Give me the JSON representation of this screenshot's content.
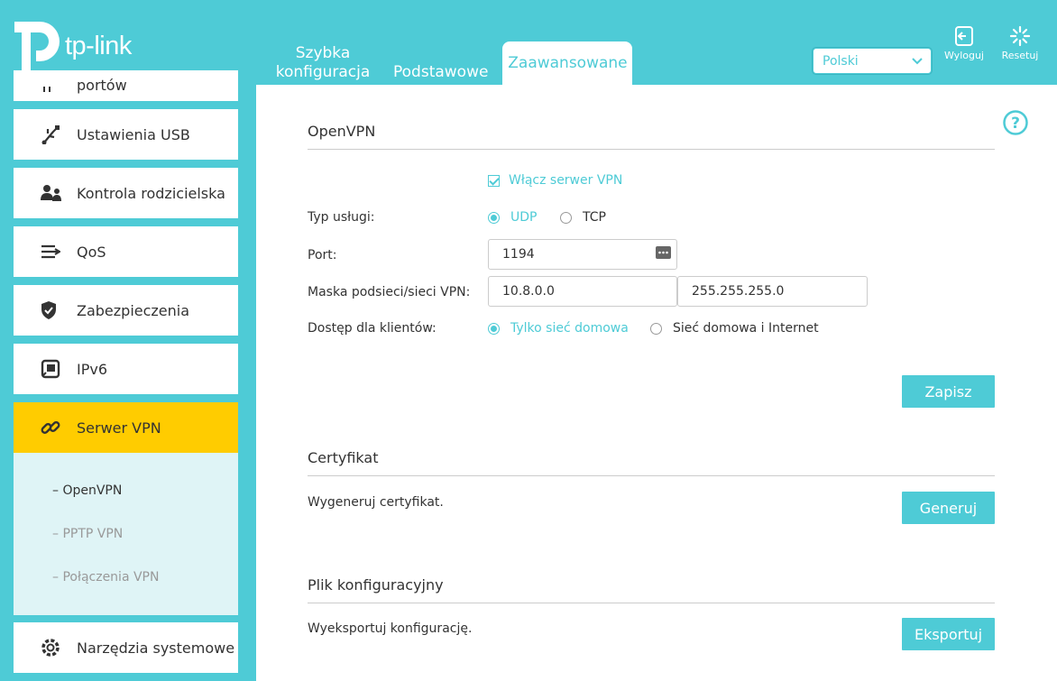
{
  "brand": {
    "logo_text": "tp-link"
  },
  "header": {
    "tabs": [
      "Szybka konfiguracja",
      "Podstawowe",
      "Zaawansowane"
    ],
    "language": "Polski",
    "logout_label": "Wyloguj",
    "reset_label": "Resetuj"
  },
  "sidebar": {
    "items": [
      {
        "label": "portów",
        "icon": "port-forward-icon"
      },
      {
        "label": "Ustawienia USB",
        "icon": "usb-icon"
      },
      {
        "label": "Kontrola rodzicielska",
        "icon": "parental-control-icon"
      },
      {
        "label": "QoS",
        "icon": "qos-icon"
      },
      {
        "label": "Zabezpieczenia",
        "icon": "shield-icon"
      },
      {
        "label": "IPv6",
        "icon": "ipv6-icon"
      },
      {
        "label": "Serwer VPN",
        "icon": "link-icon"
      },
      {
        "label": "Narzędzia systemowe",
        "icon": "gear-icon"
      }
    ],
    "subitems": [
      "OpenVPN",
      "PPTP VPN",
      "Połączenia VPN"
    ],
    "active_color": "#ffcc00"
  },
  "openvpn": {
    "title": "OpenVPN",
    "enable_label": "Włącz serwer VPN",
    "service_type_label": "Typ usługi:",
    "udp_label": "UDP",
    "tcp_label": "TCP",
    "port_label": "Port:",
    "port_value": "1194",
    "subnet_label": "Maska podsieci/sieci VPN:",
    "subnet_value": "10.8.0.0",
    "mask_value": "255.255.255.0",
    "client_access_label": "Dostęp dla klientów:",
    "home_only_label": "Tylko sieć domowa",
    "home_internet_label": "Sieć domowa i Internet",
    "save_label": "Zapisz"
  },
  "certificate": {
    "title": "Certyfikat",
    "desc": "Wygeneruj certyfikat.",
    "button": "Generuj"
  },
  "config_file": {
    "title": "Plik konfiguracyjny",
    "desc": "Wyeksportuj konfigurację.",
    "button": "Eksportuj"
  },
  "colors": {
    "accent": "#4ecbd6",
    "active": "#ffcc00"
  }
}
